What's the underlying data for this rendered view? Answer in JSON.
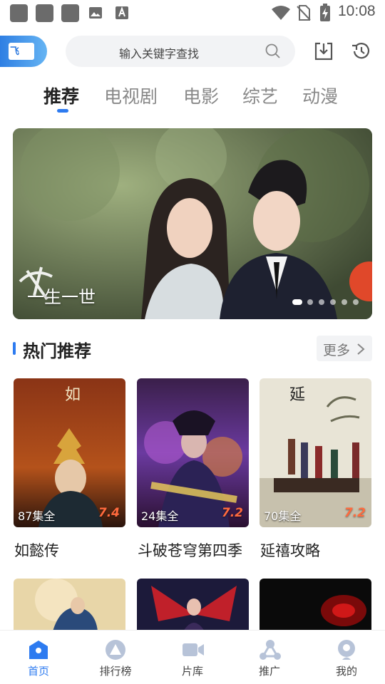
{
  "status_bar": {
    "time": "10:08",
    "icons": [
      "notification-square",
      "notification-square",
      "notification-square",
      "image-icon",
      "font-a-icon",
      "wifi-icon",
      "no-sim-icon",
      "battery-charging-icon"
    ]
  },
  "header": {
    "logo_text": "飞",
    "search_placeholder": "输入关键字查找",
    "icons": [
      "search-icon",
      "download-icon",
      "history-icon"
    ]
  },
  "tabs": [
    {
      "label": "推荐",
      "active": true
    },
    {
      "label": "电视剧",
      "active": false
    },
    {
      "label": "电影",
      "active": false
    },
    {
      "label": "综艺",
      "active": false
    },
    {
      "label": "动漫",
      "active": false
    }
  ],
  "banner": {
    "title": "一生一世",
    "slide_count": 6,
    "active_slide": 1
  },
  "section": {
    "title": "热门推荐",
    "more_label": "更多"
  },
  "cards": [
    {
      "title": "如懿传",
      "episodes": "87集全",
      "score": "7.4"
    },
    {
      "title": "斗破苍穹第四季",
      "episodes": "24集全",
      "score": "7.2"
    },
    {
      "title": "延禧攻略",
      "episodes": "70集全",
      "score": "7.2"
    }
  ],
  "bottom_nav": [
    {
      "label": "首页",
      "icon": "home-icon",
      "active": true
    },
    {
      "label": "排行榜",
      "icon": "ranking-icon",
      "active": false
    },
    {
      "label": "片库",
      "icon": "video-camera-icon",
      "active": false
    },
    {
      "label": "推广",
      "icon": "share-icon",
      "active": false
    },
    {
      "label": "我的",
      "icon": "profile-icon",
      "active": false
    }
  ],
  "colors": {
    "accent": "#2d7bf0",
    "score": "#ff6a3d",
    "search_bg": "#f2f3f5"
  }
}
